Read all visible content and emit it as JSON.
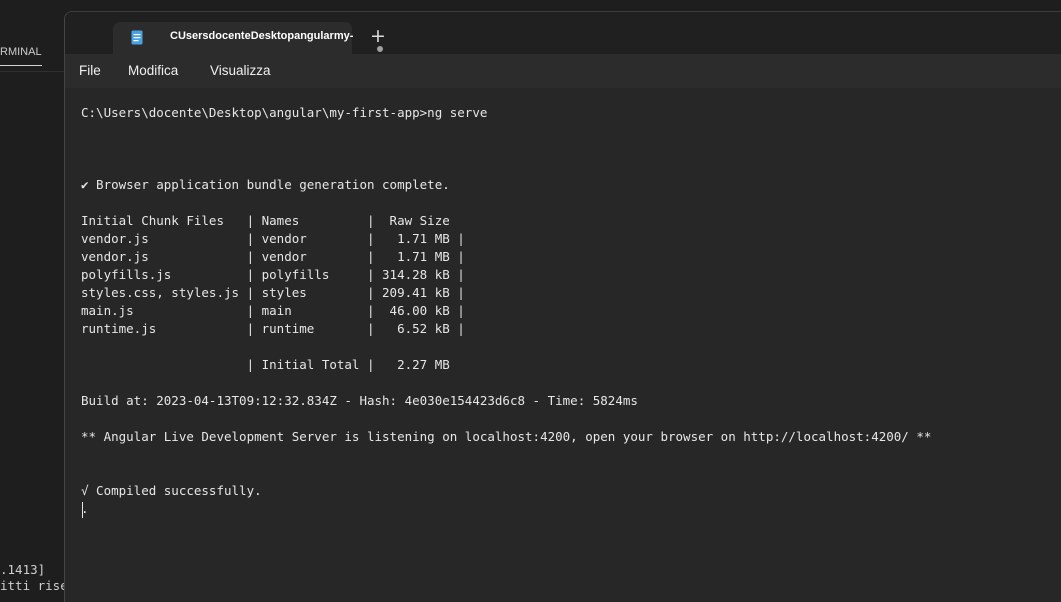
{
  "background_terminal": {
    "tab_label": "RMINAL",
    "lines": [
      ".1413]",
      "itti rise"
    ]
  },
  "notepad": {
    "tab_title": "CUsersdocenteDesktopangularmy-",
    "new_tab_symbol": "+",
    "menu": [
      "File",
      "Modifica",
      "Visualizza"
    ],
    "colors": {
      "titlebar": "#202020",
      "editor_bg": "#272727",
      "file_icon": "#4aa3df"
    },
    "content_lines": [
      "C:\\Users\\docente\\Desktop\\angular\\my-first-app>ng serve",
      "",
      "",
      "",
      "✔ Browser application bundle generation complete.",
      "",
      "Initial Chunk Files   | Names         |  Raw Size",
      "vendor.js             | vendor        |   1.71 MB |",
      "vendor.js             | vendor        |   1.71 MB |",
      "polyfills.js          | polyfills     | 314.28 kB |",
      "styles.css, styles.js | styles        | 209.41 kB |",
      "main.js               | main          |  46.00 kB |",
      "runtime.js            | runtime       |   6.52 kB |",
      "",
      "                      | Initial Total |   2.27 MB",
      "",
      "Build at: 2023-04-13T09:12:32.834Z - Hash: 4e030e154423d6c8 - Time: 5824ms",
      "",
      "** Angular Live Development Server is listening on localhost:4200, open your browser on http://localhost:4200/ **",
      "",
      "",
      "√ Compiled successfully.",
      "."
    ]
  }
}
